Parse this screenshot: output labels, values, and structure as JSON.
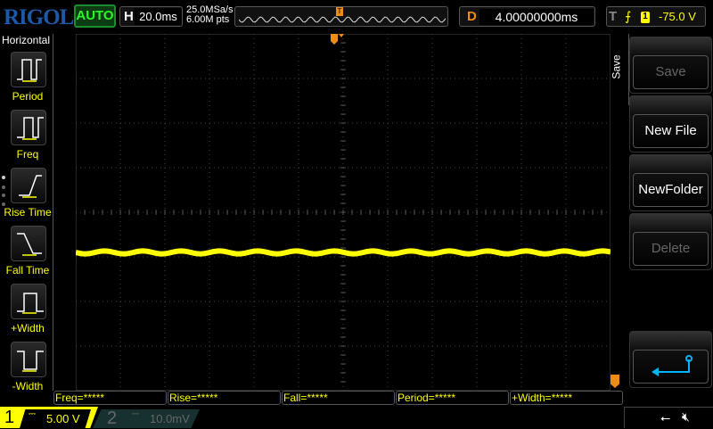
{
  "header": {
    "logo": "RIGOL",
    "run_mode": "AUTO",
    "horizontal_key": "H",
    "timebase": "20.0ms",
    "sample_rate": "25.0MSa/s",
    "memory_depth": "6.00M pts",
    "delay_key": "D",
    "delay": "4.00000000ms",
    "trigger_key": "T",
    "trigger_edge": "rising",
    "trigger_source": "1",
    "trigger_level": "-75.0 V"
  },
  "left_menu": {
    "title": "Horizontal",
    "items": [
      {
        "label": "Period",
        "icon": "period-icon"
      },
      {
        "label": "Freq",
        "icon": "freq-icon"
      },
      {
        "label": "Rise Time",
        "icon": "rise-time-icon"
      },
      {
        "label": "Fall Time",
        "icon": "fall-time-icon"
      },
      {
        "label": "+Width",
        "icon": "positive-width-icon"
      },
      {
        "label": "-Width",
        "icon": "negative-width-icon"
      }
    ]
  },
  "right_menu": {
    "tab": "Save",
    "buttons": [
      {
        "label": "Save",
        "enabled": false
      },
      {
        "label": "New File",
        "enabled": true
      },
      {
        "label": "NewFolder",
        "enabled": true
      },
      {
        "label": "Delete",
        "enabled": false
      }
    ],
    "back_icon": "return-arrow-icon"
  },
  "measurements": [
    "Freq=*****",
    "Rise=*****",
    "Fall=*****",
    "Period=*****",
    "+Width=*****"
  ],
  "channels": [
    {
      "num": "1",
      "coupling": "DC",
      "scale": "5.00 V",
      "color": "#ffff00",
      "active": true
    },
    {
      "num": "2",
      "coupling": "DC",
      "scale": "10.0mV",
      "color": "#00c8ff",
      "active": false
    }
  ],
  "status_icons": [
    "usb-icon",
    "sound-muted-icon"
  ],
  "colors": {
    "ch1": "#ffff00",
    "trigger": "#f08c14",
    "accent": "#00b4ff"
  }
}
